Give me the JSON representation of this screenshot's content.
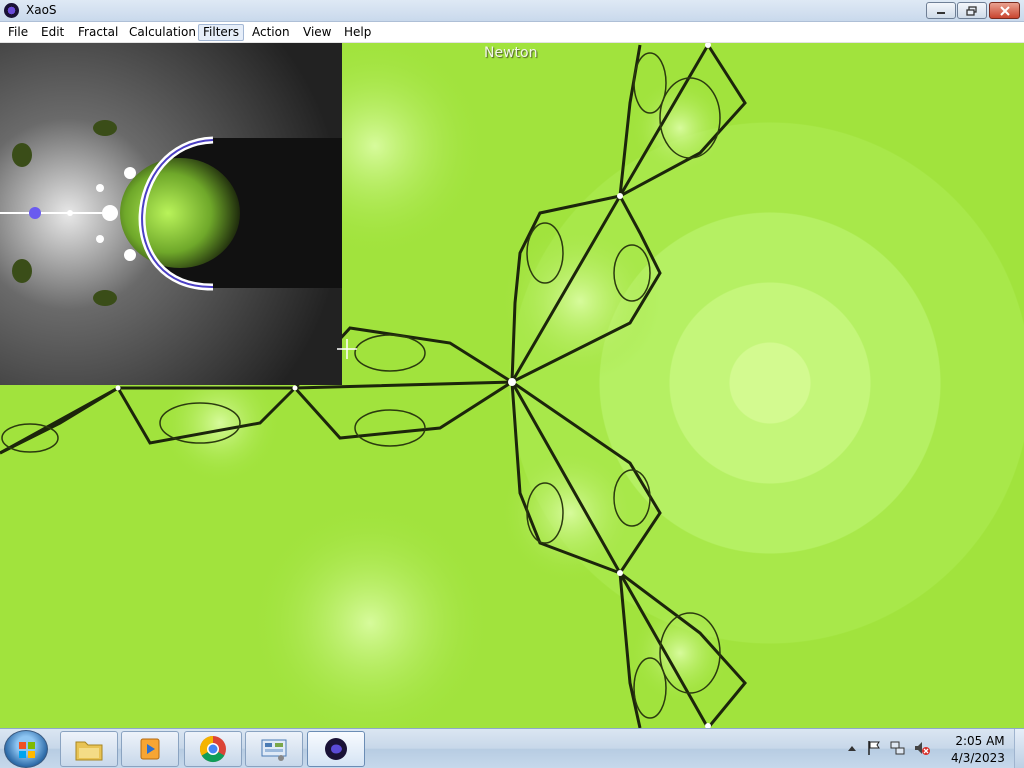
{
  "window": {
    "title": "XaoS",
    "app_icon": "xaos-icon",
    "controls": {
      "minimize": "minimize-icon",
      "maximize": "maximize-icon",
      "close": "close-icon"
    }
  },
  "menubar": {
    "items": [
      "File",
      "Edit",
      "Fractal",
      "Calculation",
      "Filters",
      "Action",
      "View",
      "Help"
    ],
    "active_item": "Filters"
  },
  "canvas": {
    "label": "Newton",
    "main_fractal_colors": {
      "background": "#a1e33d",
      "highlight": "#d3fa90",
      "filaments": "#1a1f0a"
    },
    "preview_fractal_colors": {
      "background": "#3b3b3b",
      "light": "#ffffff",
      "accent": "#5b4bd6",
      "green": "#a5e83c"
    }
  },
  "taskbar": {
    "start": "windows-start-icon",
    "pinned": [
      "file-explorer-icon",
      "media-player-icon",
      "chrome-icon",
      "control-panel-icon",
      "xaos-icon"
    ],
    "tray_icons": [
      "show-hidden-icons-icon",
      "action-center-flag-icon",
      "network-icon",
      "volume-muted-icon"
    ],
    "clock": {
      "time": "2:05 AM",
      "date": "4/3/2023"
    }
  }
}
